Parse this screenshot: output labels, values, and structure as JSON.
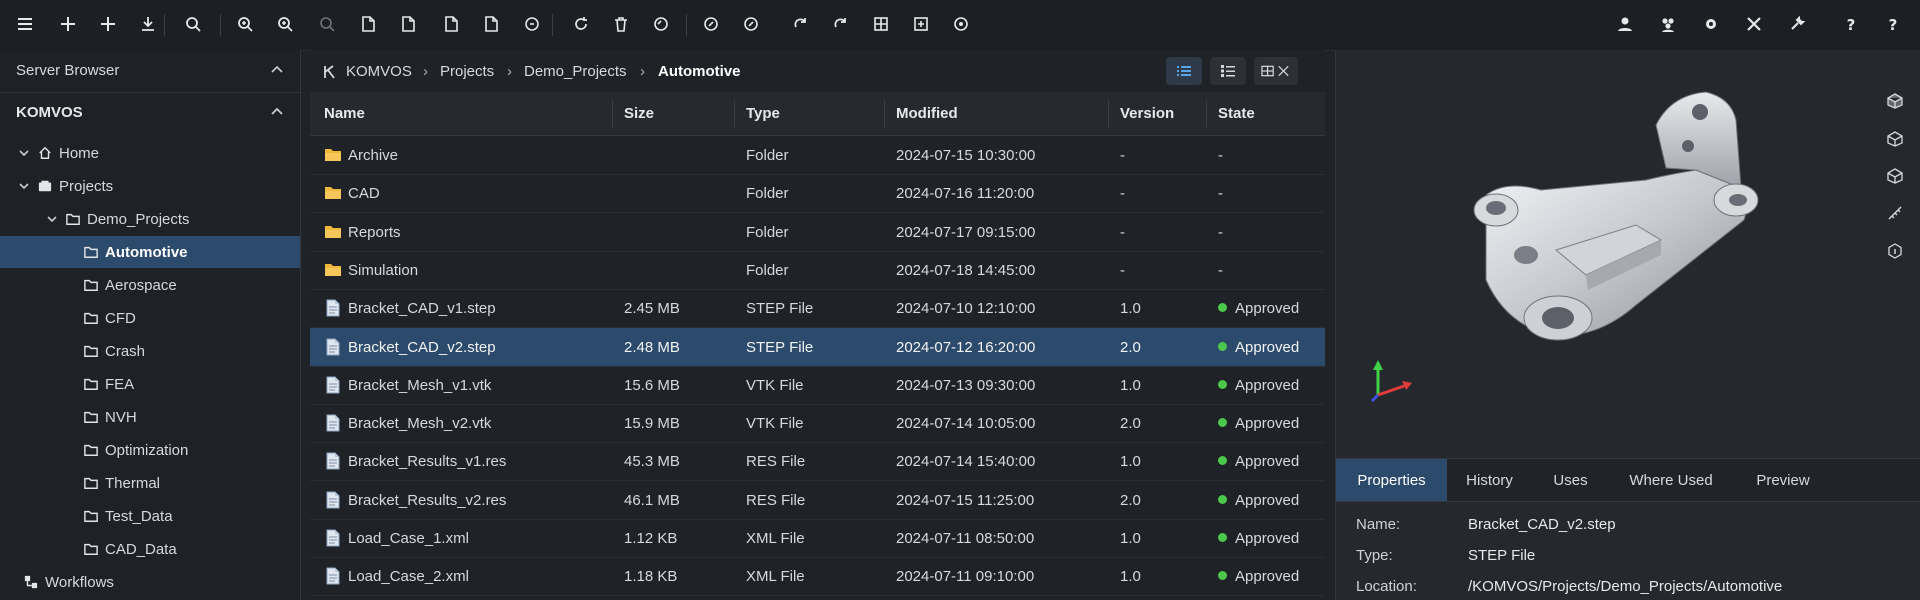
{
  "toolbar": {
    "icons": [
      "menu-icon",
      "plus-icon",
      "plus-icon",
      "download-icon",
      "search-icon",
      "zoom-in-icon",
      "zoom-in-icon",
      "zoom-icon",
      "document-icon",
      "document-icon",
      "document-icon",
      "document-icon",
      "cycle-icon",
      "refresh-icon",
      "trash-icon",
      "undo-icon",
      "link-icon",
      "link-icon",
      "redo-icon",
      "redo-icon",
      "grid-icon",
      "export-icon",
      "settings-icon",
      "user-icon",
      "users-icon",
      "gear-icon",
      "tools-icon",
      "wrench-icon",
      "help-icon",
      "help-icon"
    ]
  },
  "left_panel": {
    "title": "Server Browser",
    "section": "KOMVOS",
    "tree": [
      {
        "label": "Home",
        "level": 0,
        "icon": "home-icon"
      },
      {
        "label": "Projects",
        "level": 0,
        "icon": "projects-icon"
      },
      {
        "label": "Demo_Projects",
        "level": 1,
        "icon": "folder-icon"
      },
      {
        "label": "Automotive",
        "level": 2,
        "icon": "folder-icon",
        "selected": true
      },
      {
        "label": "Aerospace",
        "level": 2,
        "icon": "folder-icon"
      },
      {
        "label": "CFD",
        "level": 2,
        "icon": "folder-icon"
      },
      {
        "label": "Crash",
        "level": 2,
        "icon": "folder-icon"
      },
      {
        "label": "FEA",
        "level": 2,
        "icon": "folder-icon"
      },
      {
        "label": "NVH",
        "level": 2,
        "icon": "folder-icon"
      },
      {
        "label": "Optimization",
        "level": 2,
        "icon": "folder-icon"
      },
      {
        "label": "Thermal",
        "level": 2,
        "icon": "folder-icon"
      },
      {
        "label": "Test_Data",
        "level": 2,
        "icon": "folder-icon"
      },
      {
        "label": "CAD_Data",
        "level": 2,
        "icon": "folder-icon"
      },
      {
        "label": "Workflows",
        "level": 0,
        "icon": "workflow-icon"
      }
    ]
  },
  "breadcrumb": [
    "KOMVOS",
    "Projects",
    "Demo_Projects",
    "Automotive"
  ],
  "file_table": {
    "columns": [
      "Name",
      "Size",
      "Type",
      "Modified",
      "Version",
      "State"
    ],
    "rows": [
      {
        "name": "Archive",
        "size": "",
        "type": "Folder",
        "modified": "2024-07-15 10:30:00",
        "version": "-",
        "state": "-",
        "kind": "folder"
      },
      {
        "name": "CAD",
        "size": "",
        "type": "Folder",
        "modified": "2024-07-16 11:20:00",
        "version": "-",
        "state": "-",
        "kind": "folder"
      },
      {
        "name": "Reports",
        "size": "",
        "type": "Folder",
        "modified": "2024-07-17 09:15:00",
        "version": "-",
        "state": "-",
        "kind": "folder"
      },
      {
        "name": "Simulation",
        "size": "",
        "type": "Folder",
        "modified": "2024-07-18 14:45:00",
        "version": "-",
        "state": "-",
        "kind": "folder"
      },
      {
        "name": "Bracket_CAD_v1.step",
        "size": "2.45 MB",
        "type": "STEP File",
        "modified": "2024-07-10 12:10:00",
        "version": "1.0",
        "state": "Approved",
        "kind": "file"
      },
      {
        "name": "Bracket_CAD_v2.step",
        "size": "2.48 MB",
        "type": "STEP File",
        "modified": "2024-07-12 16:20:00",
        "version": "2.0",
        "state": "Approved",
        "kind": "file",
        "selected": true
      },
      {
        "name": "Bracket_Mesh_v1.vtk",
        "size": "15.6 MB",
        "type": "VTK File",
        "modified": "2024-07-13 09:30:00",
        "version": "1.0",
        "state": "Approved",
        "kind": "file"
      },
      {
        "name": "Bracket_Mesh_v2.vtk",
        "size": "15.9 MB",
        "type": "VTK File",
        "modified": "2024-07-14 10:05:00",
        "version": "2.0",
        "state": "Approved",
        "kind": "file"
      },
      {
        "name": "Bracket_Results_v1.res",
        "size": "45.3 MB",
        "type": "RES File",
        "modified": "2024-07-14 15:40:00",
        "version": "1.0",
        "state": "Approved",
        "kind": "file"
      },
      {
        "name": "Bracket_Results_v2.res",
        "size": "46.1 MB",
        "type": "RES File",
        "modified": "2024-07-15 11:25:00",
        "version": "2.0",
        "state": "Approved",
        "kind": "file"
      },
      {
        "name": "Load_Case_1.xml",
        "size": "1.12 KB",
        "type": "XML File",
        "modified": "2024-07-11 08:50:00",
        "version": "1.0",
        "state": "Approved",
        "kind": "file"
      },
      {
        "name": "Load_Case_2.xml",
        "size": "1.18 KB",
        "type": "XML File",
        "modified": "2024-07-11 09:10:00",
        "version": "1.0",
        "state": "Approved",
        "kind": "file"
      }
    ]
  },
  "detail_tabs": [
    "Properties",
    "History",
    "Uses",
    "Where Used",
    "Preview"
  ],
  "properties": [
    {
      "label": "Name:",
      "value": "Bracket_CAD_v2.step"
    },
    {
      "label": "Type:",
      "value": "STEP File"
    },
    {
      "label": "Location:",
      "value": "/KOMVOS/Projects/Demo_Projects/Automotive"
    }
  ],
  "colors": {
    "background": "#1f2226",
    "selection": "#2c4a6b",
    "accent": "#5aa3e6",
    "approved": "#4cc94c",
    "folder": "#f0b73d"
  }
}
